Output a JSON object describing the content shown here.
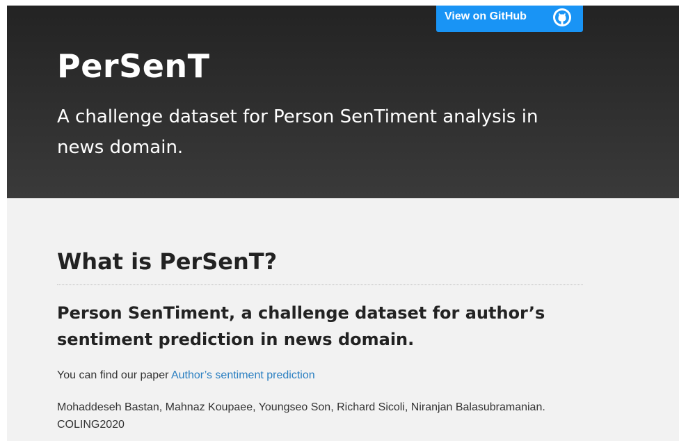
{
  "header": {
    "github_button": {
      "label": "View on GitHub",
      "icon": "github-octocat-icon"
    },
    "title": "PerSenT",
    "description": "A challenge dataset for Person SenTiment analysis in news domain."
  },
  "main": {
    "heading": "What is PerSenT?",
    "subheading": "Person SenTiment, a challenge dataset for author’s sentiment prediction in news domain.",
    "paper_prefix": "You can find our paper",
    "paper_link": "Author’s sentiment prediction",
    "authors": "Mohaddeseh Bastan, Mahnaz Koupaee, Youngseo Son, Richard Sicoli, Niranjan Balasubramanian. COLING2020"
  },
  "colors": {
    "header_bg": "#2b2b2b",
    "button_blue": "#1994f5",
    "link_blue": "#2a7fc1",
    "body_bg": "#f2f2f2"
  }
}
